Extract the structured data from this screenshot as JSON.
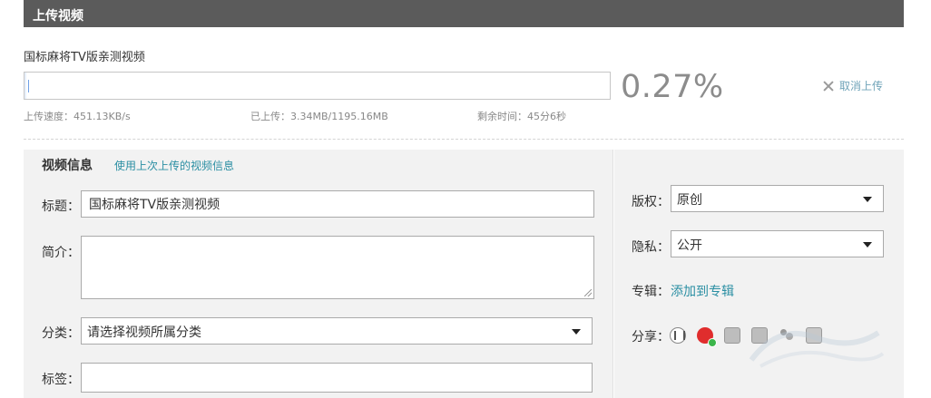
{
  "header": {
    "title": "上传视频"
  },
  "upload": {
    "file_name": "国标麻将TV版亲测视频",
    "progress_percent": 0.27,
    "percent_label": "0.27%",
    "cancel_label": "取消上传",
    "speed_label": "上传速度：",
    "speed_value": "451.13KB/s",
    "uploaded_label": "已上传：",
    "uploaded_value": "3.34MB/1195.16MB",
    "remaining_label": "剩余时间：",
    "remaining_value": "45分6秒"
  },
  "video_info": {
    "section_title": "视频信息",
    "reuse_link": "使用上次上传的视频信息",
    "title_label": "标题：",
    "title_value": "国标麻将TV版亲测视频",
    "intro_label": "简介：",
    "intro_value": "",
    "category_label": "分类：",
    "category_value": "请选择视频所属分类",
    "tags_label": "标签：",
    "tags_value": ""
  },
  "side": {
    "copyright_label": "版权：",
    "copyright_value": "原创",
    "privacy_label": "隐私：",
    "privacy_value": "公开",
    "album_label": "专辑：",
    "album_link": "添加到专辑",
    "share_label": "分享："
  },
  "share_icons": [
    "renren-icon",
    "weibo-icon",
    "share-gray-icon",
    "share-photo-icon",
    "share-people-icon",
    "share-grid-icon"
  ],
  "colors": {
    "header_bg": "#5b5b5b",
    "link": "#2b8fa3",
    "panel_bg": "#f2f2f2",
    "weibo": "#e02d2d"
  }
}
